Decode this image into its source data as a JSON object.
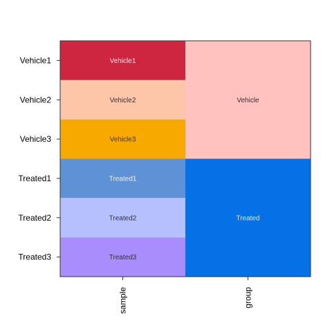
{
  "chart_data": {
    "type": "heatmap",
    "rows": [
      "Vehicle1",
      "Vehicle2",
      "Vehicle3",
      "Treated1",
      "Treated2",
      "Treated3"
    ],
    "columns": [
      "sample",
      "group"
    ],
    "sample_cells": [
      {
        "label": "Vehicle1",
        "color": "#CE2640",
        "text_color": "#F0E6E8"
      },
      {
        "label": "Vehicle2",
        "color": "#FDC6A9",
        "text_color": "#333333"
      },
      {
        "label": "Vehicle3",
        "color": "#F7A900",
        "text_color": "#333333"
      },
      {
        "label": "Treated1",
        "color": "#5E91D6",
        "text_color": "#E9EEF7"
      },
      {
        "label": "Treated2",
        "color": "#B7C0FE",
        "text_color": "#333333"
      },
      {
        "label": "Treated3",
        "color": "#AA8DFC",
        "text_color": "#333333"
      }
    ],
    "group_blocks": [
      {
        "label": "Vehicle",
        "color": "#FFC2BF",
        "text_color": "#333333",
        "rows": [
          0,
          2
        ]
      },
      {
        "label": "Treated",
        "color": "#0671E6",
        "text_color": "#DDE9F8",
        "rows": [
          3,
          5
        ]
      }
    ]
  }
}
